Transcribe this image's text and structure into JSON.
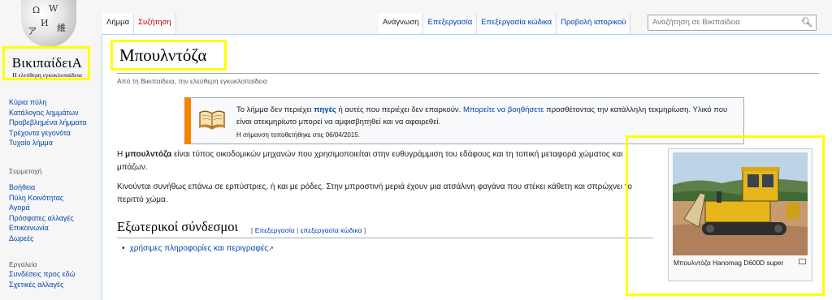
{
  "logo": {
    "wordmark": "ΒικιπαίδειΑ",
    "tagline": "Η ελεύθερη εγκυκλοπαίδεια"
  },
  "sidebar": {
    "main_links": [
      "Κύρια πύλη",
      "Κατάλογος λημμάτων",
      "Προβεβλημένα λήμματα",
      "Τρέχοντα γεγονότα",
      "Τυχαίο λήμμα"
    ],
    "participation_heading": "Συμμετοχή",
    "participation_links": [
      "Βοήθεια",
      "Πύλη Κοινότητας",
      "Αγορά",
      "Πρόσφατες αλλαγές",
      "Επικοινωνία",
      "Δωρεές"
    ],
    "tools_heading": "Εργαλεία",
    "tools_links": [
      "Συνδέσεις προς εδώ",
      "Σχετικές αλλαγές"
    ]
  },
  "tabs": {
    "article": "Λήμμα",
    "talk": "Συζήτηση",
    "read": "Ανάγνωση",
    "edit": "Επεξεργασία",
    "edit_source": "Επεξεργασία κώδικα",
    "history": "Προβολή ιστορικού"
  },
  "search": {
    "placeholder": "Αναζήτηση σε Βικιπαίδεια"
  },
  "article": {
    "title": "Μπουλντόζα",
    "subtitle": "Από τη Βικιπαίδεια, την ελεύθερη εγκυκλοπαίδεια",
    "notice": {
      "text_before": "Το λήμμα δεν περιέχει ",
      "link_sources": "πηγές",
      "text_mid": " ή αυτές που περιέχει δεν επαρκούν. ",
      "link_help": "Μπορείτε να βοηθήσετε",
      "text_after": " προσθέτοντας την κατάλληλη τεκμηρίωση. Υλικό που είναι ατεκμηρίωτο μπορεί να αμφισβητηθεί και να αφαιρεθεί.",
      "date_note": "Η σήμανση τοποθετήθηκε στις 06/04/2015."
    },
    "para1_bold": "μπουλντόζα",
    "para1_pre": "Η ",
    "para1_rest": " είναι τύπος οικοδομικών μηχανών που χρησιμοποιείται στην ευθυγράμμιση του εδάφους και τη τοπική μεταφορά χώματος και μπάζων.",
    "para2": "Κινούνται συνήθως επάνω σε ερπύστριες, ή και με ρόδες. Στην μπροστινή μεριά έχουν μια ατσάλινη φαγάνα που στέκει κάθετη και σπρώχνει το περιττό χώμα.",
    "section_heading": "Εξωτερικοί σύνδεσμοι",
    "section_edit_open": "[ ",
    "section_edit": "Επεξεργασία",
    "section_sep": " | ",
    "section_edit_source": "επεξεργασία κώδικα",
    "section_edit_close": " ]",
    "external_link": "χρήσιμες πληροφορίες και περιγραφές",
    "image_caption": "Μπουλντόζα Hanomag D600D super"
  },
  "colors": {
    "link": "#0645ad",
    "notice_bar": "#f28500",
    "highlight": "#ffff00"
  }
}
